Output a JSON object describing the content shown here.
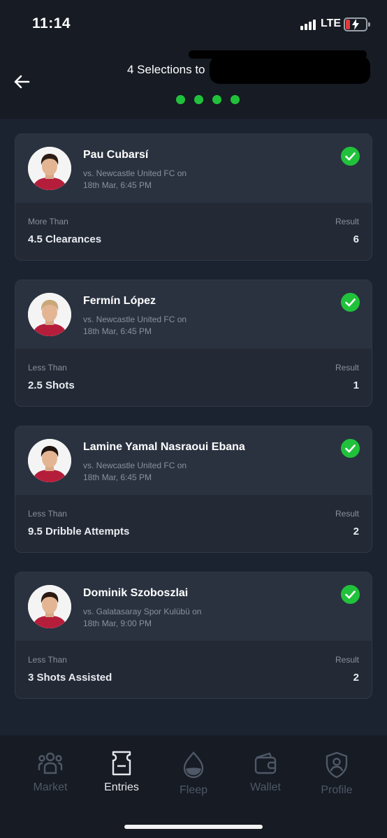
{
  "status_bar": {
    "time": "11:14",
    "network": "LTE"
  },
  "header": {
    "title": "4 Selections to",
    "step_count": 4,
    "accent_color": "#21c23b"
  },
  "selections": [
    {
      "player": "Pau Cubarsí",
      "match": "vs. Newcastle United FC on",
      "date": "18th Mar, 6:45 PM",
      "bet_type": "More Than",
      "bet": "4.5 Clearances",
      "result_label": "Result",
      "result": "6",
      "status": "won"
    },
    {
      "player": "Fermín López",
      "match": "vs. Newcastle United FC on",
      "date": "18th Mar, 6:45 PM",
      "bet_type": "Less Than",
      "bet": "2.5 Shots",
      "result_label": "Result",
      "result": "1",
      "status": "won"
    },
    {
      "player": "Lamine Yamal Nasraoui Ebana",
      "match": "vs. Newcastle United FC on",
      "date": "18th Mar, 6:45 PM",
      "bet_type": "Less Than",
      "bet": "9.5 Dribble Attempts",
      "result_label": "Result",
      "result": "2",
      "status": "won"
    },
    {
      "player": "Dominik Szoboszlai",
      "match": "vs. Galatasaray Spor Kulübü on",
      "date": "18th Mar, 9:00 PM",
      "bet_type": "Less Than",
      "bet": "3 Shots Assisted",
      "result_label": "Result",
      "result": "2",
      "status": "won"
    }
  ],
  "tabbar": {
    "items": [
      {
        "label": "Market",
        "icon": "users-icon",
        "active": false
      },
      {
        "label": "Entries",
        "icon": "ticket-icon",
        "active": true
      },
      {
        "label": "Fleep",
        "icon": "drop-icon",
        "active": false
      },
      {
        "label": "Wallet",
        "icon": "wallet-icon",
        "active": false
      },
      {
        "label": "Profile",
        "icon": "shield-user-icon",
        "active": false
      }
    ]
  }
}
